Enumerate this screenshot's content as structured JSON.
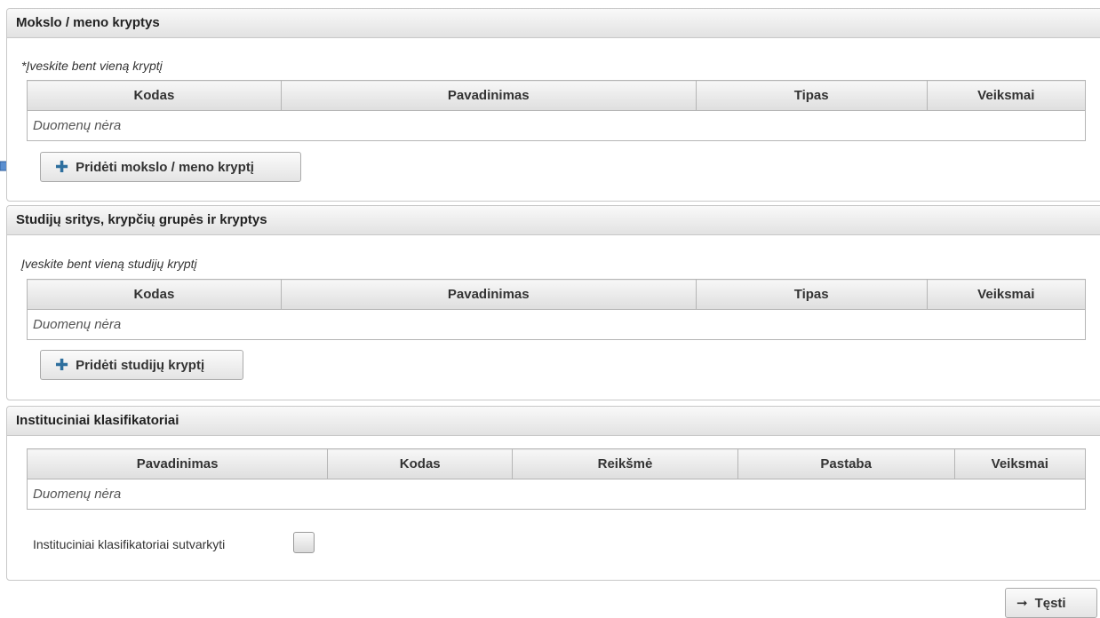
{
  "sections": [
    {
      "title": "Mokslo / meno kryptys",
      "hint": "*Įveskite bent vieną kryptį",
      "columns": [
        "Kodas",
        "Pavadinimas",
        "Tipas",
        "Veiksmai"
      ],
      "empty_text": "Duomenų nėra",
      "add_button": "Pridėti mokslo / meno kryptį"
    },
    {
      "title": "Studijų sritys, krypčių grupės ir kryptys",
      "hint": "Įveskite bent vieną studijų kryptį",
      "columns": [
        "Kodas",
        "Pavadinimas",
        "Tipas",
        "Veiksmai"
      ],
      "empty_text": "Duomenų nėra",
      "add_button": "Pridėti studijų kryptį"
    },
    {
      "title": "Instituciniai klasifikatoriai",
      "columns": [
        "Pavadinimas",
        "Kodas",
        "Reikšmė",
        "Pastaba",
        "Veiksmai"
      ],
      "empty_text": "Duomenų nėra",
      "checkbox_label": "Instituciniai klasifikatoriai sutvarkyti",
      "checkbox_checked": false
    }
  ],
  "continue_button": "Tęsti",
  "icons": {
    "plus": "plus-icon",
    "arrow_right": "arrow-right-icon",
    "annotation_arrow": "annotation-arrow-icon"
  },
  "colors": {
    "accent": "#2e6f9e",
    "annotation_arrow": "#5b8fd0"
  }
}
